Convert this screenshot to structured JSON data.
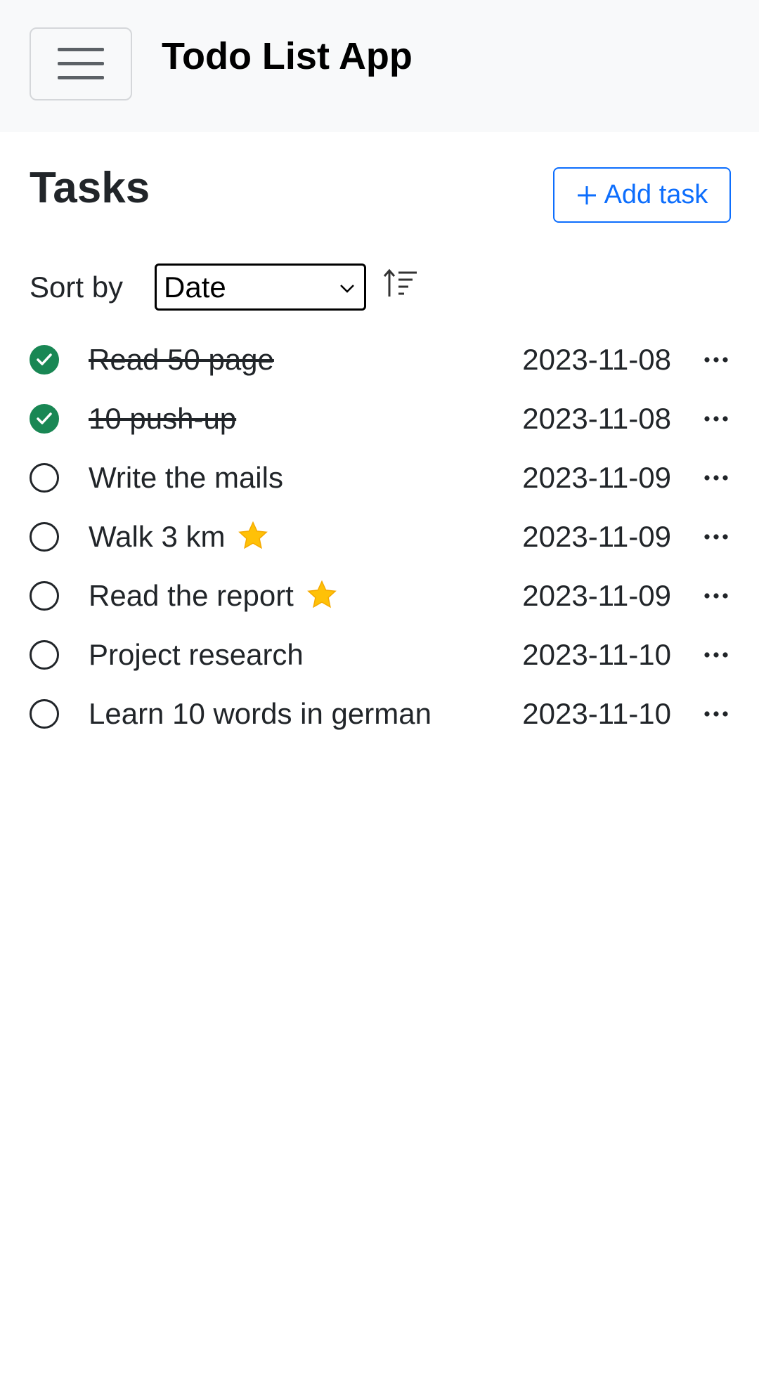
{
  "navbar": {
    "menu_icon": "hamburger-icon",
    "title": "Todo List App"
  },
  "header": {
    "title": "Tasks",
    "add_button_label": "Add task",
    "add_icon": "plus-icon"
  },
  "sort": {
    "label": "Sort by",
    "selected": "Date",
    "direction_icon": "sort-ascending-icon"
  },
  "colors": {
    "done_check": "#198754",
    "accent": "#0d6efd",
    "star": "#ffc107"
  },
  "tasks": [
    {
      "title": "Read 50 page",
      "date": "2023-11-08",
      "done": true,
      "starred": false
    },
    {
      "title": "10 push-up",
      "date": "2023-11-08",
      "done": true,
      "starred": false
    },
    {
      "title": "Write the mails",
      "date": "2023-11-09",
      "done": false,
      "starred": false
    },
    {
      "title": "Walk 3 km",
      "date": "2023-11-09",
      "done": false,
      "starred": true
    },
    {
      "title": "Read the report",
      "date": "2023-11-09",
      "done": false,
      "starred": true
    },
    {
      "title": "Project research",
      "date": "2023-11-10",
      "done": false,
      "starred": false
    },
    {
      "title": "Learn 10 words in german",
      "date": "2023-11-10",
      "done": false,
      "starred": false
    }
  ]
}
